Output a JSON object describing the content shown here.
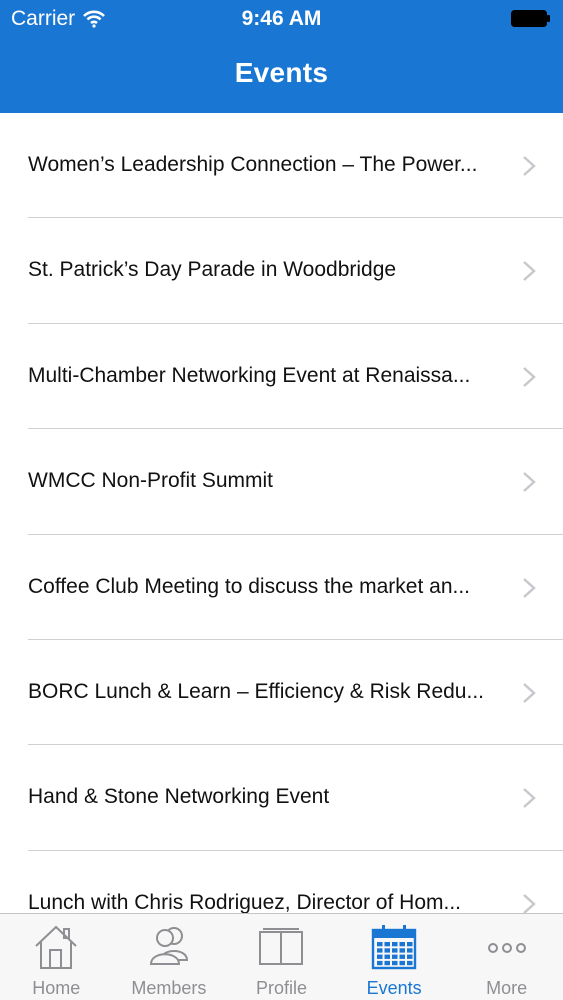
{
  "status_bar": {
    "carrier": "Carrier",
    "time": "9:46 AM"
  },
  "nav": {
    "title": "Events"
  },
  "events": [
    {
      "title": "Women’s Leadership Connection – The Power..."
    },
    {
      "title": "St. Patrick’s  Day Parade in Woodbridge"
    },
    {
      "title": "Multi-Chamber Networking Event at Renaissa..."
    },
    {
      "title": "WMCC Non-Profit Summit"
    },
    {
      "title": "Coffee Club Meeting to discuss the market an..."
    },
    {
      "title": "BORC Lunch & Learn – Efficiency & Risk Redu..."
    },
    {
      "title": "Hand & Stone Networking Event"
    },
    {
      "title": "Lunch with Chris Rodriguez, Director of Hom..."
    }
  ],
  "tabbar": {
    "tabs": [
      {
        "label": "Home",
        "icon": "house-icon",
        "active": false
      },
      {
        "label": "Members",
        "icon": "members-icon",
        "active": false
      },
      {
        "label": "Profile",
        "icon": "book-icon",
        "active": false
      },
      {
        "label": "Events",
        "icon": "calendar-icon",
        "active": true
      },
      {
        "label": "More",
        "icon": "more-dots-icon",
        "active": false
      }
    ]
  },
  "colors": {
    "header_bg": "#1976d2",
    "active_tab": "#1976d2",
    "inactive_tab": "#8e8e93",
    "separator": "#d0d0d4",
    "chevron": "#c7c7cc"
  }
}
